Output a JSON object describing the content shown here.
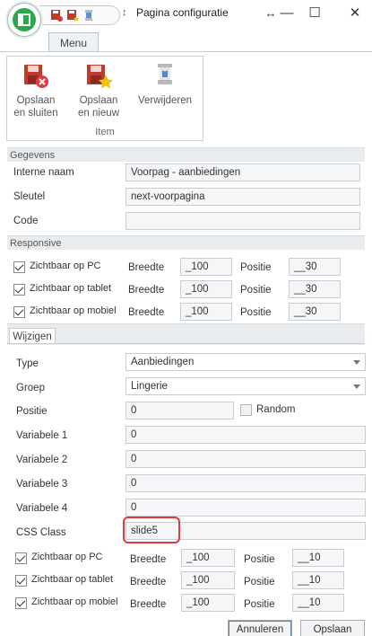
{
  "window": {
    "title": "Pagina configuratie",
    "qat_separator": "↕",
    "controls": {
      "move": "↔",
      "minimize": "—",
      "maximize": "☐",
      "close": "✕"
    }
  },
  "menu": {
    "tab_label": "Menu"
  },
  "ribbon": {
    "buttons": [
      {
        "label_line1": "Opslaan",
        "label_line2": "en sluiten",
        "icon": "save-close-icon"
      },
      {
        "label_line1": "Opslaan",
        "label_line2": "en nieuw",
        "icon": "save-new-icon"
      },
      {
        "label_line1": "Verwijderen",
        "label_line2": "",
        "icon": "delete-icon"
      }
    ],
    "group_label": "Item"
  },
  "gegevens": {
    "header": "Gegevens",
    "interne_naam_label": "Interne naam",
    "interne_naam_value": "Voorpag - aanbiedingen",
    "sleutel_label": "Sleutel",
    "sleutel_value": "next-voorpagina",
    "code_label": "Code",
    "code_value": ""
  },
  "responsive": {
    "header": "Responsive",
    "rows": [
      {
        "label": "Zichtbaar op PC",
        "checked": true,
        "breedte_label": "Breedte",
        "breedte": "_100",
        "positie_label": "Positie",
        "positie": "__30"
      },
      {
        "label": "Zichtbaar op tablet",
        "checked": true,
        "breedte_label": "Breedte",
        "breedte": "_100",
        "positie_label": "Positie",
        "positie": "__30"
      },
      {
        "label": "Zichtbaar op mobiel",
        "checked": true,
        "breedte_label": "Breedte",
        "breedte": "_100",
        "positie_label": "Positie",
        "positie": "__30"
      }
    ]
  },
  "wijzigen": {
    "tab_label": "Wijzigen",
    "type_label": "Type",
    "type_value": "Aanbiedingen",
    "groep_label": "Groep",
    "groep_value": "Lingerie",
    "positie_label": "Positie",
    "positie_value": "0",
    "random_label": "Random",
    "variabele1_label": "Variabele 1",
    "variabele1_value": "0",
    "variabele2_label": "Variabele 2",
    "variabele2_value": "0",
    "variabele3_label": "Variabele 3",
    "variabele3_value": "0",
    "variabele4_label": "Variabele 4",
    "variabele4_value": "0",
    "css_class_label": "CSS Class",
    "css_class_value": "slide5",
    "rows": [
      {
        "label": "Zichtbaar op PC",
        "checked": true,
        "breedte_label": "Breedte",
        "breedte": "_100",
        "positie_label": "Positie",
        "positie": "__10"
      },
      {
        "label": "Zichtbaar op tablet",
        "checked": true,
        "breedte_label": "Breedte",
        "breedte": "_100",
        "positie_label": "Positie",
        "positie": "__10"
      },
      {
        "label": "Zichtbaar op mobiel",
        "checked": true,
        "breedte_label": "Breedte",
        "breedte": "_100",
        "positie_label": "Positie",
        "positie": "__10"
      }
    ]
  },
  "footer": {
    "cancel_label": "Annuleren",
    "save_label": "Opslaan"
  },
  "colors": {
    "highlight": "#e03a3a",
    "app_icon": "#2aa84a",
    "section_bg": "#e9ecef"
  }
}
